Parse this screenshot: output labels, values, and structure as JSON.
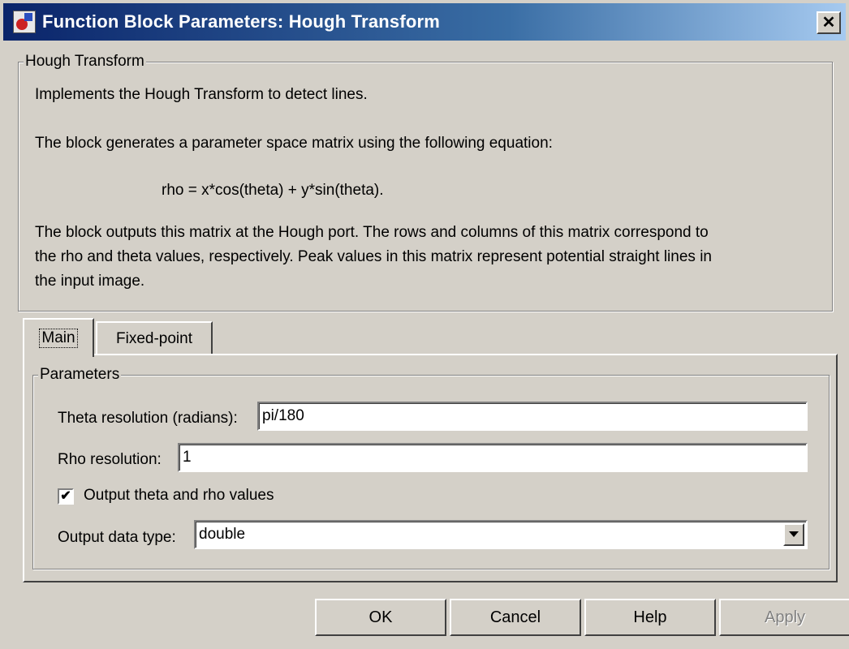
{
  "window": {
    "title": "Function Block Parameters: Hough Transform",
    "close_label": "✕"
  },
  "description_group": {
    "legend": "Hough Transform",
    "lines": [
      "Implements the Hough Transform to detect lines.",
      "The block generates a parameter space matrix using the following equation:",
      "rho = x*cos(theta) + y*sin(theta).",
      "The block outputs this matrix at the Hough port. The rows and columns of this matrix correspond to",
      "the rho and theta values, respectively. Peak values in this matrix represent potential straight lines in",
      "the input image."
    ]
  },
  "tabs": [
    {
      "label": "Main",
      "active": true
    },
    {
      "label": "Fixed-point",
      "active": false
    }
  ],
  "parameters": {
    "legend": "Parameters",
    "theta_resolution": {
      "label": "Theta resolution (radians):",
      "value": "pi/180"
    },
    "rho_resolution": {
      "label": "Rho resolution:",
      "value": "1"
    },
    "output_theta_rho": {
      "label": "Output theta and rho values",
      "checked": true,
      "mark": "✔"
    },
    "output_data_type": {
      "label": "Output data type:",
      "value": "double"
    }
  },
  "buttons": {
    "ok": "OK",
    "cancel": "Cancel",
    "help": "Help",
    "apply": "Apply"
  }
}
